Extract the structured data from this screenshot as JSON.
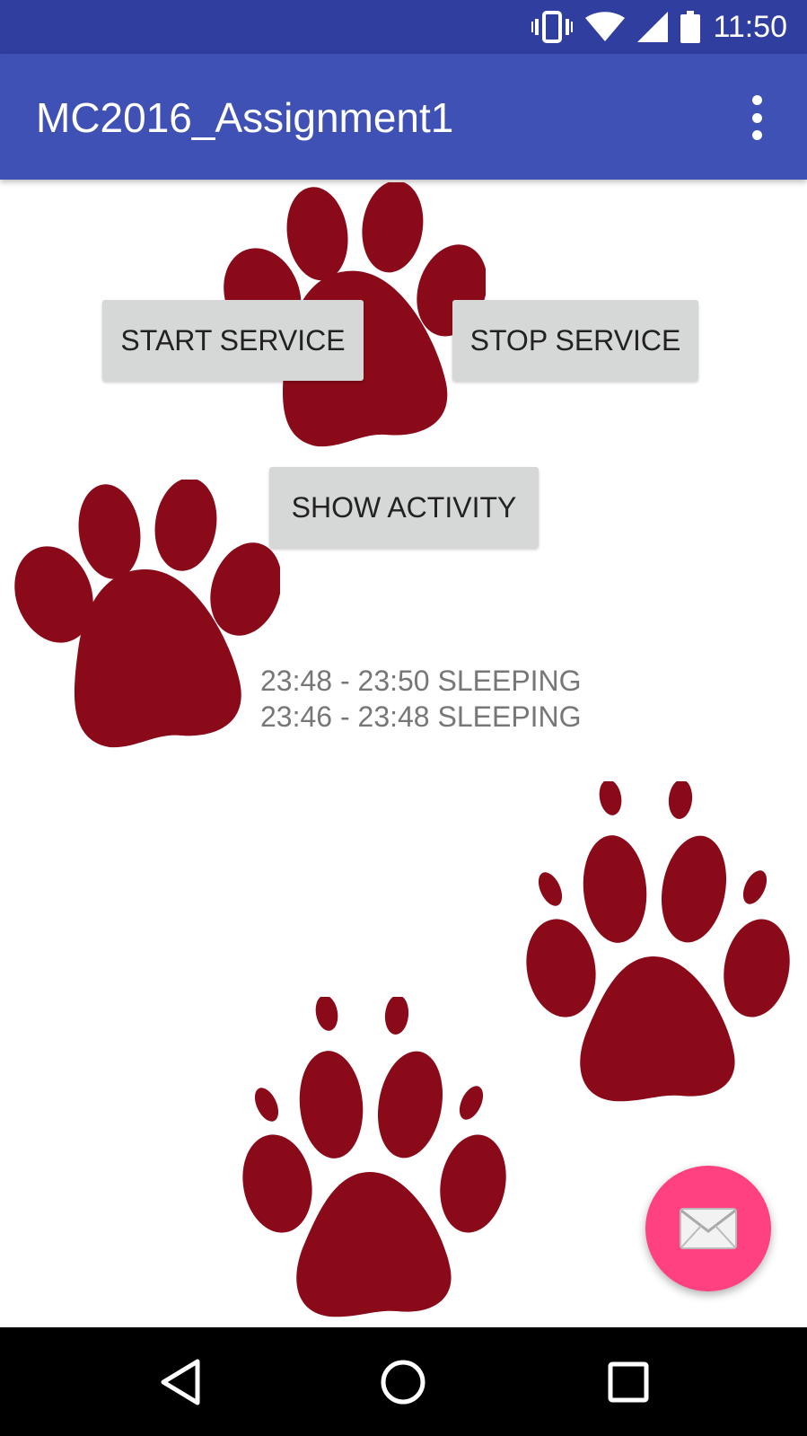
{
  "status_bar": {
    "time": "11:50",
    "icons": [
      "vibrate-icon",
      "wifi-icon",
      "cell-signal-icon",
      "battery-icon"
    ],
    "color": "#303F9F"
  },
  "app_bar": {
    "title": "MC2016_Assignment1",
    "menu_icon": "overflow-menu-icon",
    "color": "#3F51B5"
  },
  "buttons": {
    "start_service": "START SERVICE",
    "stop_service": "STOP SERVICE",
    "show_activity": "SHOW ACTIVITY"
  },
  "activity_log": [
    "23:48 - 23:50 SLEEPING",
    "23:46 - 23:48 SLEEPING"
  ],
  "fab": {
    "icon": "mail-icon",
    "color": "#FF4081"
  },
  "nav_bar": {
    "icons": [
      "back-icon",
      "home-icon",
      "recents-icon"
    ]
  },
  "background_decor": {
    "icon": "paw-print-icon",
    "count": 4,
    "color": "#8B0A1A"
  }
}
